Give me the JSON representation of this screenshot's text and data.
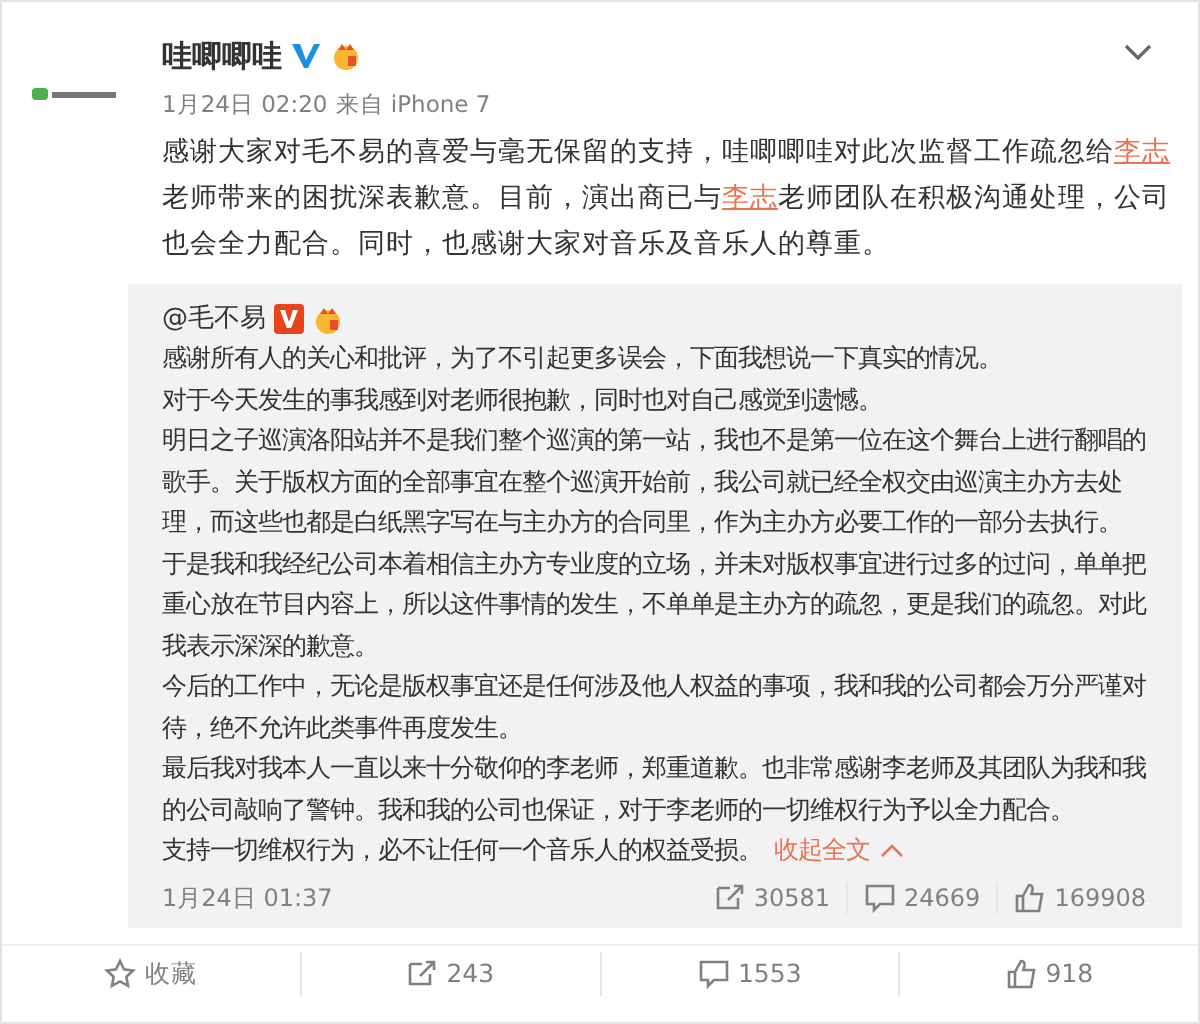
{
  "post": {
    "author": "哇唧唧哇",
    "time": "1月24日 02:20",
    "source": "来自 iPhone 7",
    "text": [
      {
        "kind": "plain",
        "text": "感谢大家对毛不易的喜爱与毫无保留的支持，哇唧唧哇对此次监督工作疏忽给"
      },
      {
        "kind": "mention",
        "text": "李志"
      },
      {
        "kind": "plain",
        "text": "老师带来的困扰深表歉意。目前，演出商已与"
      },
      {
        "kind": "mention",
        "text": "李志"
      },
      {
        "kind": "plain",
        "text": "老师团队在积极沟通处理，公司也会全力配合。同时，也感谢大家对音乐及音乐人的尊重。"
      }
    ]
  },
  "repost": {
    "author": "@毛不易",
    "paragraphs": [
      "感谢所有人的关心和批评，为了不引起更多误会，下面我想说一下真实的情况。",
      "对于今天发生的事我感到对老师很抱歉，同时也对自己感觉到遗憾。",
      "明日之子巡演洛阳站并不是我们整个巡演的第一站，我也不是第一位在这个舞台上进行翻唱的歌手。关于版权方面的全部事宜在整个巡演开始前，我公司就已经全权交由巡演主办方去处理，而这些也都是白纸黑字写在与主办方的合同里，作为主办方必要工作的一部分去执行。",
      "于是我和我经纪公司本着相信主办方专业度的立场，并未对版权事宜进行过多的过问，单单把重心放在节目内容上，所以这件事情的发生，不单单是主办方的疏忽，更是我们的疏忽。对此我表示深深的歉意。",
      "今后的工作中，无论是版权事宜还是任何涉及他人权益的事项，我和我的公司都会万分严谨对待，绝不允许此类事件再度发生。",
      "最后我对我本人一直以来十分敬仰的李老师，郑重道歉。也非常感谢李老师及其团队为我和我的公司敲响了警钟。我和我的公司也保证，对于李老师的一切维权行为予以全力配合。",
      "支持一切维权行为，必不让任何一个音乐人的权益受损。"
    ],
    "collapse_link": "收起全文",
    "time": "1月24日 01:37",
    "stats": [
      {
        "kind": "repost",
        "count": "30581"
      },
      {
        "kind": "comment",
        "count": "24669"
      },
      {
        "kind": "like",
        "count": "169908"
      }
    ]
  },
  "actions": [
    {
      "kind": "favorite",
      "label": "收藏"
    },
    {
      "kind": "repost",
      "label": "243"
    },
    {
      "kind": "comment",
      "label": "1553"
    },
    {
      "kind": "like",
      "label": "918"
    }
  ]
}
